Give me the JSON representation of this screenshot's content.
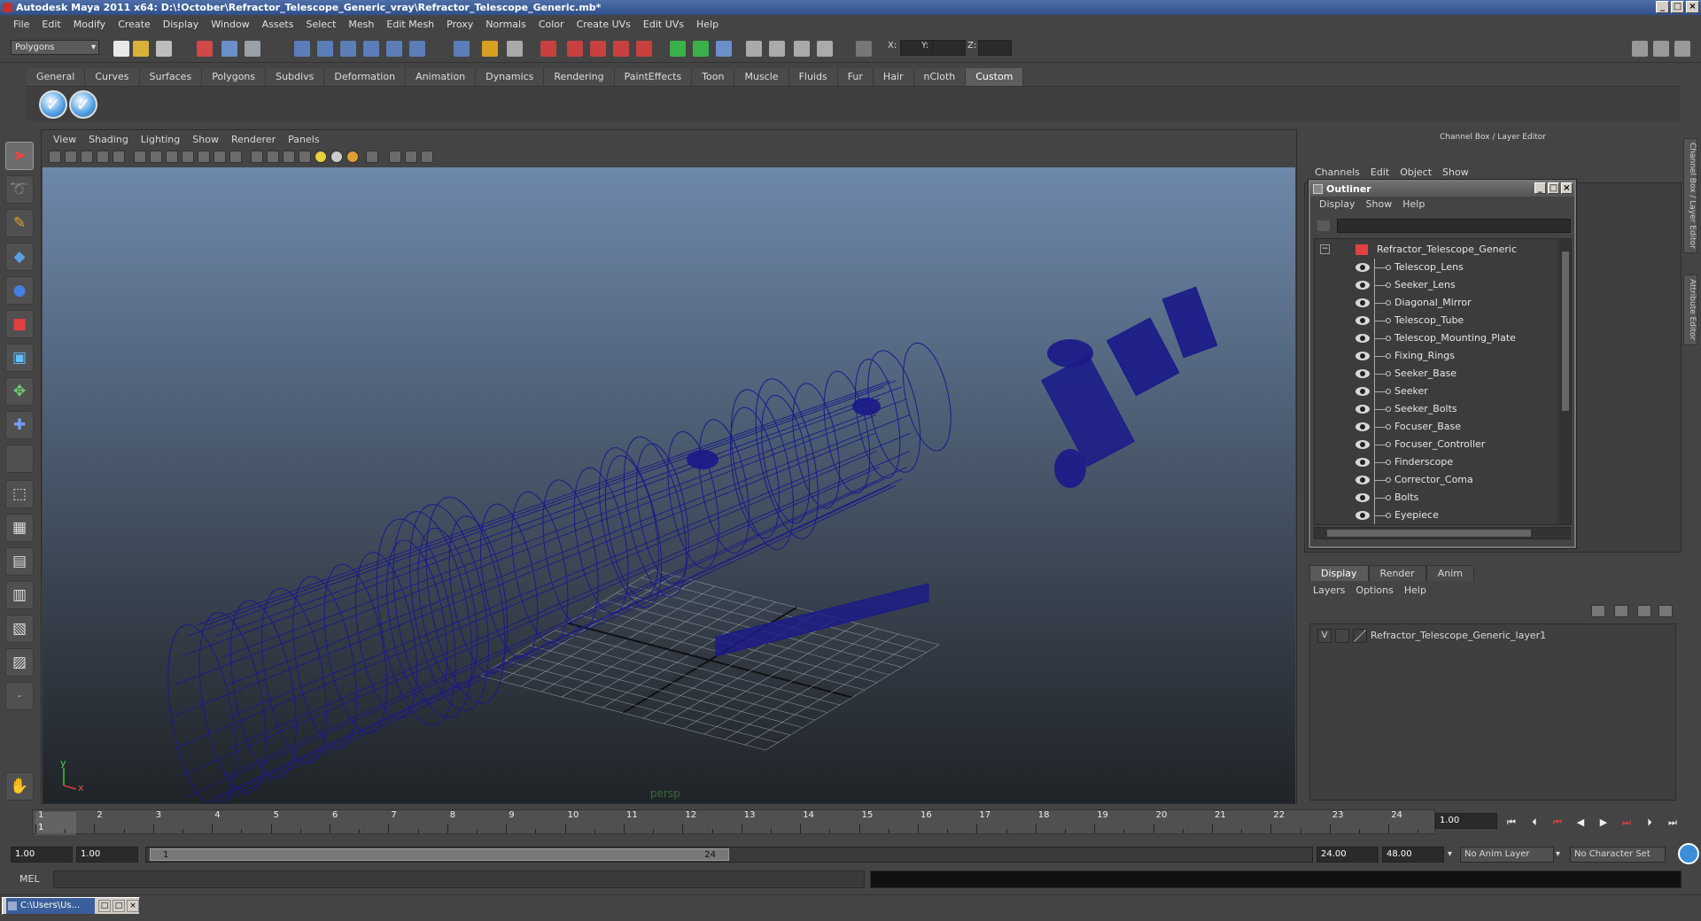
{
  "window": {
    "title": "Autodesk Maya 2011 x64: D:\\!October\\Refractor_Telescope_Generic_vray\\Refractor_Telescope_Generic.mb*",
    "min": "_",
    "max": "□",
    "close": "×"
  },
  "menubar": [
    "File",
    "Edit",
    "Modify",
    "Create",
    "Display",
    "Window",
    "Assets",
    "Select",
    "Mesh",
    "Edit Mesh",
    "Proxy",
    "Normals",
    "Color",
    "Create UVs",
    "Edit UVs",
    "Help"
  ],
  "statusline": {
    "mode": "Polygons",
    "x_label": "X:",
    "y_label": "Y:",
    "z_label": "Z:"
  },
  "shelf": {
    "tabs": [
      "General",
      "Curves",
      "Surfaces",
      "Polygons",
      "Subdivs",
      "Deformation",
      "Animation",
      "Dynamics",
      "Rendering",
      "PaintEffects",
      "Toon",
      "Muscle",
      "Fluids",
      "Fur",
      "Hair",
      "nCloth",
      "Custom"
    ],
    "active_tab": "Custom",
    "button_glyph": "✓"
  },
  "viewport": {
    "menu": [
      "View",
      "Shading",
      "Lighting",
      "Show",
      "Renderer",
      "Panels"
    ],
    "camera_label": "persp",
    "axis_y": "y",
    "axis_x": "x",
    "wire_color": "#1a1a8a"
  },
  "channelbox": {
    "header": "Channel Box / Layer Editor",
    "menu": [
      "Channels",
      "Edit",
      "Object",
      "Show"
    ],
    "side_tabs": [
      "Channel Box / Layer Editor",
      "Attribute Editor"
    ]
  },
  "outliner": {
    "title": "Outliner",
    "menu": [
      "Display",
      "Show",
      "Help"
    ],
    "root": "Refractor_Telescope_Generic",
    "expand": "−",
    "items": [
      "Telescop_Lens",
      "Seeker_Lens",
      "Diagonal_Mirror",
      "Telescop_Tube",
      "Telescop_Mounting_Plate",
      "Fixing_Rings",
      "Seeker_Base",
      "Seeker",
      "Seeker_Bolts",
      "Focuser_Base",
      "Focuser_Controller",
      "Finderscope",
      "Corrector_Coma",
      "Bolts",
      "Eyepiece"
    ]
  },
  "layers": {
    "tabs": [
      "Display",
      "Render",
      "Anim"
    ],
    "menu": [
      "Layers",
      "Options",
      "Help"
    ],
    "visible_flag": "V",
    "layer_name": "Refractor_Telescope_Generic_layer1"
  },
  "timeline": {
    "ticks": [
      "1",
      "2",
      "3",
      "4",
      "5",
      "6",
      "7",
      "8",
      "9",
      "10",
      "11",
      "12",
      "13",
      "14",
      "15",
      "16",
      "17",
      "18",
      "19",
      "20",
      "21",
      "22",
      "23",
      "24"
    ],
    "current_frame": "1",
    "current_frame_field": "1.00"
  },
  "range": {
    "start": "1.00",
    "playback_start": "1.00",
    "thumb_start": "1",
    "thumb_end": "24",
    "playback_end": "24.00",
    "end": "48.00",
    "anim_layer": "No Anim Layer",
    "character_set": "No Character Set"
  },
  "command": {
    "label": "MEL"
  },
  "taskbar": {
    "item": "C:\\Users\\Us..."
  }
}
